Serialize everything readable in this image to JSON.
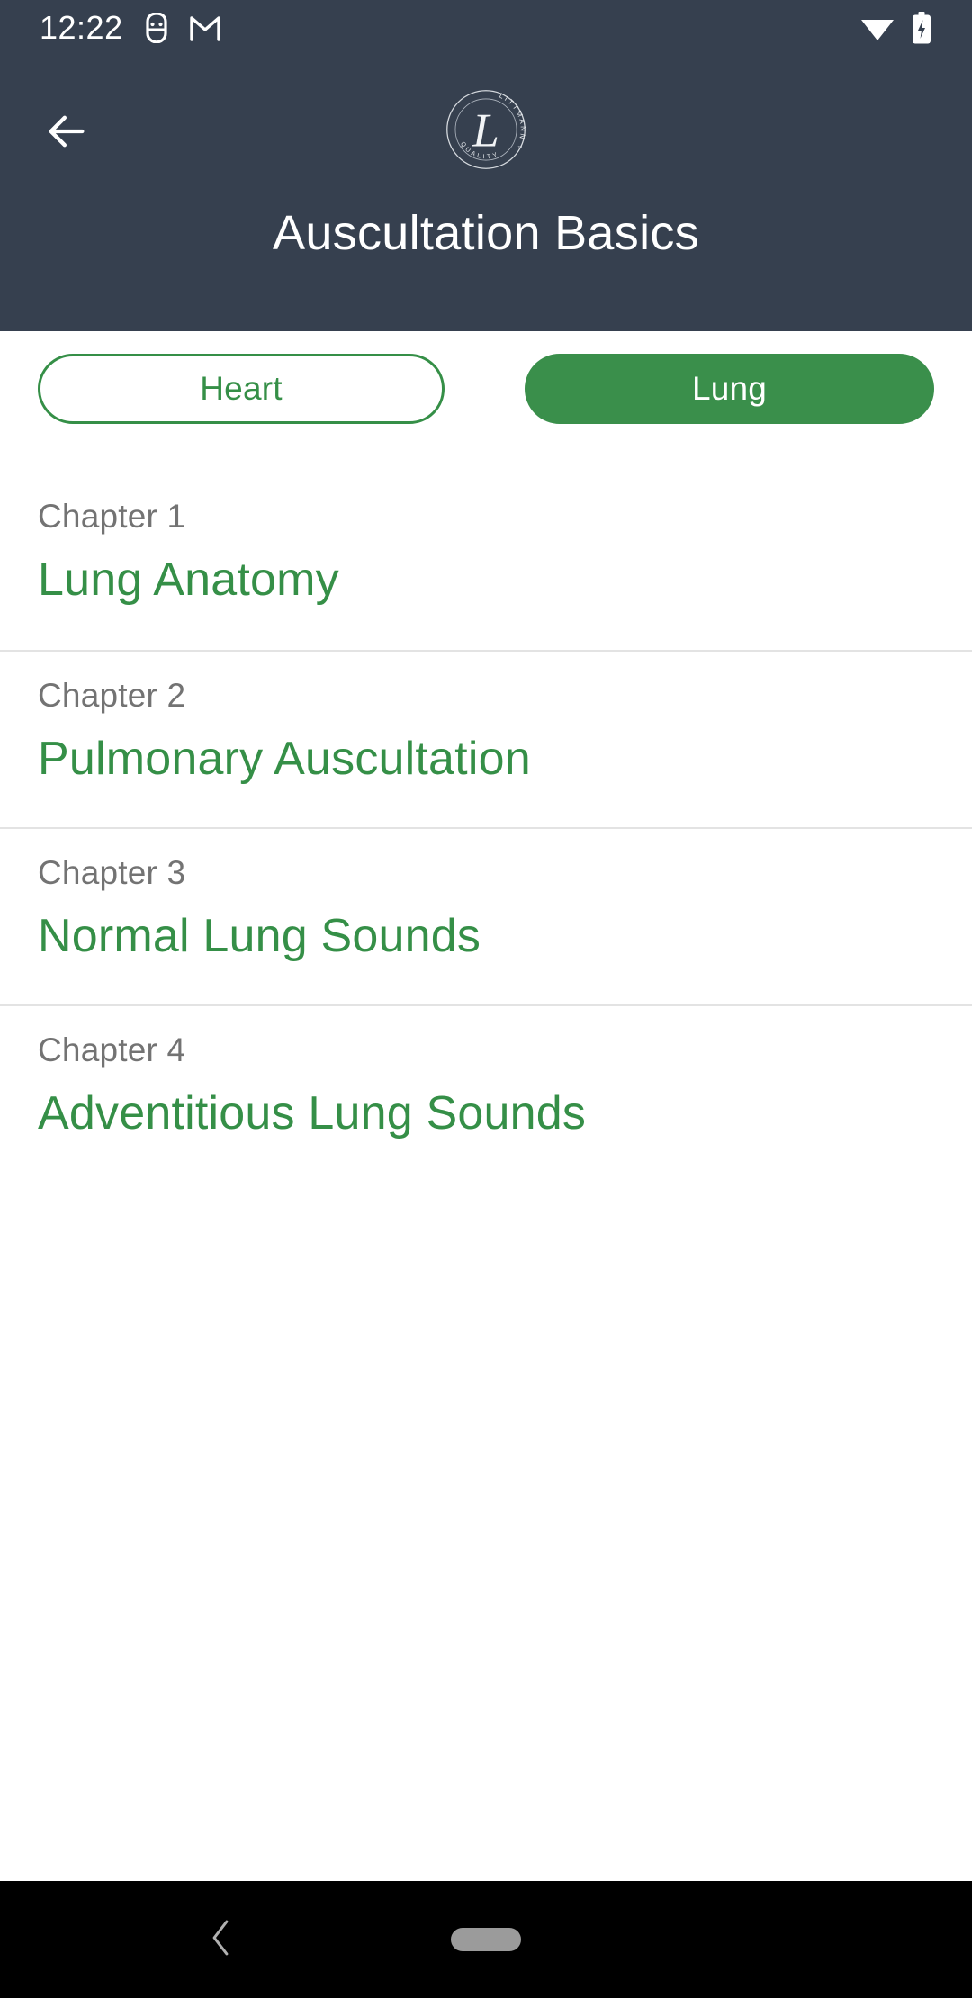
{
  "status_bar": {
    "time": "12:22",
    "icons": [
      "android-app-icon",
      "gmail-icon",
      "wifi-icon",
      "battery-charging-icon"
    ]
  },
  "header": {
    "title": "Auscultation Basics",
    "back_icon": "arrow-left-icon",
    "logo": {
      "name": "littmann-quality-seal-logo",
      "monogram": "L",
      "arc_top_text": "LITTMANN",
      "arc_bottom_text": "QUALITY",
      "trademark": "™"
    },
    "background_color": "#36404f",
    "text_color": "#ffffff"
  },
  "segments": {
    "options": [
      {
        "label": "Heart",
        "selected": false
      },
      {
        "label": "Lung",
        "selected": true
      }
    ]
  },
  "chapters": [
    {
      "label": "Chapter 1",
      "title": "Lung Anatomy"
    },
    {
      "label": "Chapter 2",
      "title": "Pulmonary Auscultation"
    },
    {
      "label": "Chapter 3",
      "title": "Normal Lung Sounds"
    },
    {
      "label": "Chapter 4",
      "title": "Adventitious Lung Sounds"
    }
  ],
  "nav_bar": {
    "back_icon": "chevron-left-icon",
    "home_indicator": "home-pill-indicator",
    "background_color": "#000000"
  },
  "colors": {
    "accent_green": "#358f47",
    "active_green": "#3a8f4b",
    "header_navy": "#36404f",
    "label_gray": "#737373",
    "divider": "#e3e3e3"
  }
}
